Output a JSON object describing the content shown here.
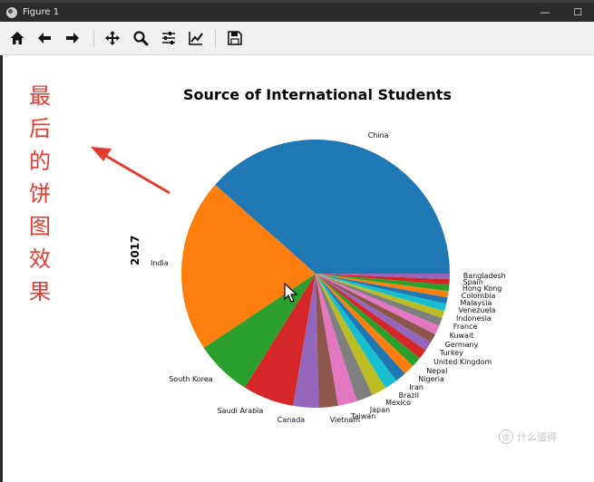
{
  "window": {
    "title": "Figure 1",
    "minimize_glyph": "—",
    "maximize_glyph": "☐"
  },
  "toolbar": {
    "items": [
      {
        "name": "home-icon"
      },
      {
        "name": "back-arrow-icon"
      },
      {
        "name": "forward-arrow-icon"
      },
      {
        "name": "pan-icon"
      },
      {
        "name": "zoom-icon"
      },
      {
        "name": "configure-subplots-icon"
      },
      {
        "name": "edit-axis-icon"
      },
      {
        "name": "save-icon"
      }
    ]
  },
  "annotation": {
    "chars": [
      "最",
      "后",
      "的",
      "饼",
      "图",
      "效",
      "果"
    ],
    "color": "#e53a2f"
  },
  "watermark": {
    "text": "什么值得"
  },
  "chart_data": {
    "type": "pie",
    "title": "Source of International Students",
    "ylabel": "2017",
    "start_angle_deg": 0,
    "direction": "counterclockwise",
    "slices": [
      {
        "label": "China",
        "value": 35.0,
        "color": "#1f77b4"
      },
      {
        "label": "India",
        "value": 19.0,
        "color": "#ff7f0e"
      },
      {
        "label": "South Korea",
        "value": 6.2,
        "color": "#2ca02c"
      },
      {
        "label": "Saudi Arabia",
        "value": 5.6,
        "color": "#d62728"
      },
      {
        "label": "Canada",
        "value": 2.8,
        "color": "#9467bd"
      },
      {
        "label": "Vietnam",
        "value": 2.1,
        "color": "#8c564b"
      },
      {
        "label": "Taiwan",
        "value": 2.1,
        "color": "#e377c2"
      },
      {
        "label": "Japan",
        "value": 1.8,
        "color": "#7f7f7f"
      },
      {
        "label": "Mexico",
        "value": 1.6,
        "color": "#bcbd22"
      },
      {
        "label": "Brazil",
        "value": 1.4,
        "color": "#17becf"
      },
      {
        "label": "Iran",
        "value": 1.2,
        "color": "#1f77b4"
      },
      {
        "label": "Nigeria",
        "value": 1.2,
        "color": "#ff7f0e"
      },
      {
        "label": "Nepal",
        "value": 1.1,
        "color": "#2ca02c"
      },
      {
        "label": "United Kingdom",
        "value": 1.1,
        "color": "#d62728"
      },
      {
        "label": "Turkey",
        "value": 1.0,
        "color": "#9467bd"
      },
      {
        "label": "Germany",
        "value": 1.0,
        "color": "#8c564b"
      },
      {
        "label": "Kuwait",
        "value": 1.0,
        "color": "#e377c2"
      },
      {
        "label": "France",
        "value": 0.9,
        "color": "#7f7f7f"
      },
      {
        "label": "Indonesia",
        "value": 0.8,
        "color": "#bcbd22"
      },
      {
        "label": "Venezuela",
        "value": 0.8,
        "color": "#17becf"
      },
      {
        "label": "Malaysia",
        "value": 0.7,
        "color": "#1f77b4"
      },
      {
        "label": "Colombia",
        "value": 0.7,
        "color": "#ff7f0e"
      },
      {
        "label": "Hong Kong",
        "value": 0.7,
        "color": "#2ca02c"
      },
      {
        "label": "Spain",
        "value": 0.6,
        "color": "#d62728"
      },
      {
        "label": "Bangladesh",
        "value": 0.6,
        "color": "#9467bd"
      }
    ]
  }
}
